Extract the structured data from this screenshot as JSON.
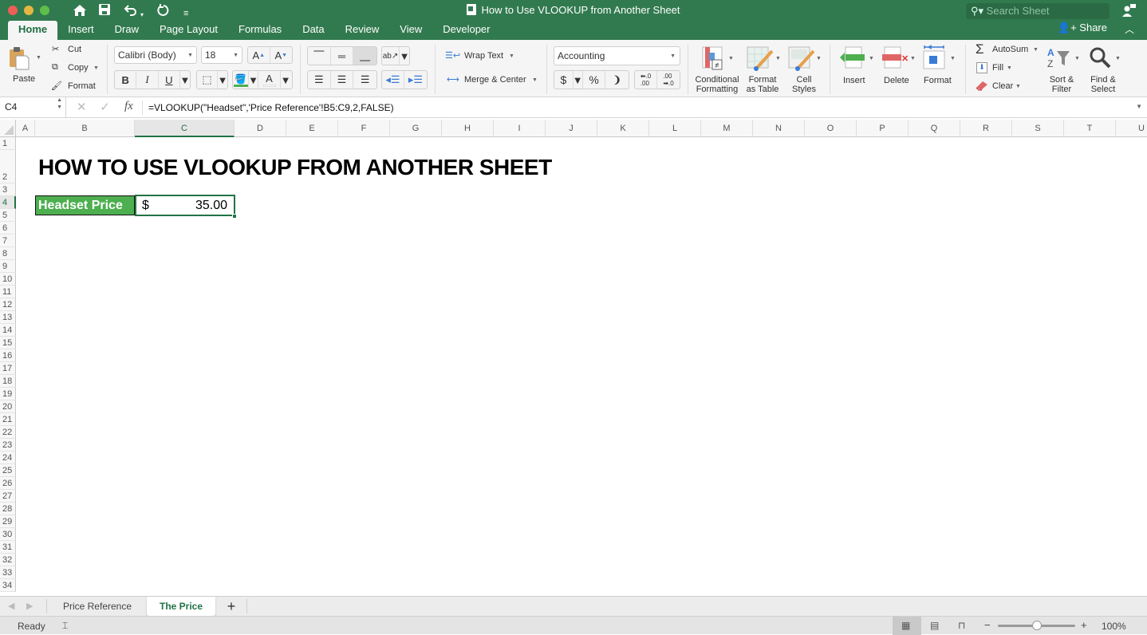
{
  "window": {
    "title": "How to Use VLOOKUP from Another Sheet",
    "search_placeholder": "Search Sheet",
    "share_label": "Share"
  },
  "quick_access": [
    {
      "name": "home-icon",
      "glyph": "⌂"
    },
    {
      "name": "save-icon",
      "glyph": "💾"
    },
    {
      "name": "undo-icon",
      "glyph": "↶"
    },
    {
      "name": "redo-icon",
      "glyph": "↺"
    },
    {
      "name": "customize-icon",
      "glyph": "≡"
    }
  ],
  "tabs": [
    {
      "label": "Home",
      "active": true
    },
    {
      "label": "Insert"
    },
    {
      "label": "Draw"
    },
    {
      "label": "Page Layout"
    },
    {
      "label": "Formulas"
    },
    {
      "label": "Data"
    },
    {
      "label": "Review"
    },
    {
      "label": "View"
    },
    {
      "label": "Developer"
    }
  ],
  "ribbon": {
    "paste": "Paste",
    "cut": "Cut",
    "copy": "Copy",
    "format_painter": "Format",
    "font_name": "Calibri (Body)",
    "font_size": "18",
    "bold": "B",
    "italic": "I",
    "underline": "U",
    "wrap_text": "Wrap Text",
    "merge_center": "Merge & Center",
    "number_format": "Accounting",
    "currency": "$",
    "percent": "%",
    "comma": "❩",
    "inc_decimal": ".0→.00",
    "dec_decimal": ".00→.0",
    "conditional_formatting": [
      "Conditional",
      "Formatting"
    ],
    "format_as_table": [
      "Format",
      "as Table"
    ],
    "cell_styles": [
      "Cell",
      "Styles"
    ],
    "insert": "Insert",
    "delete": "Delete",
    "format": "Format",
    "autosum": "AutoSum",
    "fill": "Fill",
    "clear": "Clear",
    "sort_filter": [
      "Sort &",
      "Filter"
    ],
    "find_select": [
      "Find &",
      "Select"
    ]
  },
  "formula_bar": {
    "name_box": "C4",
    "fx": "fx",
    "formula": "=VLOOKUP(\"Headset\",'Price Reference'!B5:C9,2,FALSE)"
  },
  "columns": [
    "A",
    "B",
    "C",
    "D",
    "E",
    "F",
    "G",
    "H",
    "I",
    "J",
    "K",
    "L",
    "M",
    "N",
    "O",
    "P",
    "Q",
    "R",
    "S",
    "T",
    "U"
  ],
  "selected_column": "C",
  "rows": [
    "1",
    "2",
    "3",
    "4",
    "5",
    "6",
    "7",
    "8",
    "9",
    "10",
    "11",
    "12",
    "13",
    "14",
    "15",
    "16",
    "17",
    "18",
    "19",
    "20",
    "21",
    "22",
    "23",
    "24",
    "25",
    "26",
    "27",
    "28",
    "29",
    "30",
    "31",
    "32",
    "33",
    "34"
  ],
  "selected_row": "4",
  "cells": {
    "B2": "HOW TO USE VLOOKUP FROM ANOTHER SHEET",
    "B4": "Headset Price",
    "C4_currency": "$",
    "C4_value": "35.00"
  },
  "sheets": [
    {
      "label": "Price Reference",
      "active": false
    },
    {
      "label": "The Price",
      "active": true
    }
  ],
  "add_sheet": "+",
  "status": {
    "ready": "Ready",
    "zoom": "100%",
    "zoom_minus": "−",
    "zoom_plus": "+",
    "zoom_level_fraction": 0.5
  },
  "colors": {
    "brand_green": "#317a4f",
    "accent_green": "#217346",
    "label_fill": "#4daf4f"
  }
}
